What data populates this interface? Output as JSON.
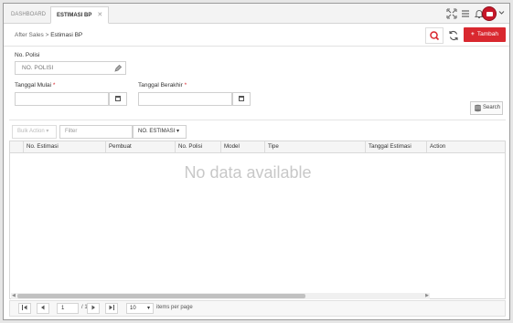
{
  "tabs": [
    {
      "label": "DASHBOARD"
    },
    {
      "label": "ESTIMASI BP",
      "close": "✕"
    }
  ],
  "header": {
    "icons": [
      "expand-icon",
      "menu-icon",
      "bell-icon",
      "user-avatar"
    ]
  },
  "breadcrumb": {
    "parent": "After Sales",
    "separator": ">",
    "current": "Estimasi BP"
  },
  "toolbar": {
    "add_label": "Tambah"
  },
  "form": {
    "no_polisi_label": "No. Polisi",
    "no_polisi_placeholder": "NO. POLISI",
    "tanggal_mulai_label": "Tanggal Mulai",
    "tanggal_berakhir_label": "Tanggal Berakhir",
    "required_mark": "*",
    "search_label": "Search"
  },
  "filterbar": {
    "bulk_action": "Bulk Action",
    "filter_placeholder": "Filter",
    "filter_field": "NO. ESTIMASI"
  },
  "grid": {
    "columns": [
      "No. Estimasi",
      "Pembuat",
      "No. Polisi",
      "Model",
      "Tipe",
      "Tanggal Estimasi",
      "Action"
    ],
    "empty_text": "No data available"
  },
  "pager": {
    "page": "1",
    "of_label": "/ 1",
    "page_size": "10",
    "per_page_label": "items per page"
  },
  "colors": {
    "accent": "#d9282f"
  }
}
